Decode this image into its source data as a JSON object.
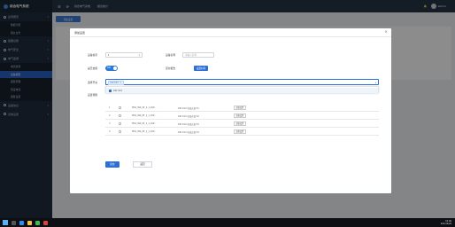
{
  "app": {
    "title": "综合电气系统"
  },
  "header": {
    "links": [
      "综合电气系统",
      "报表统计"
    ],
    "user": "admin"
  },
  "sidebar": {
    "items": [
      {
        "label": "全局概览",
        "icon": "home-icon"
      },
      {
        "label": "数据大屏",
        "sub": true
      },
      {
        "label": "报价业务",
        "sub": true
      },
      {
        "label": "提醒台账",
        "icon": "bell-icon"
      },
      {
        "label": "电气安全",
        "icon": "shield-icon"
      },
      {
        "label": "电气监测",
        "icon": "monitor-icon"
      },
      {
        "label": "电流监测",
        "sub": true
      },
      {
        "label": "设备报警",
        "sub": true,
        "active": true
      },
      {
        "label": "报警管理",
        "sub": true
      },
      {
        "label": "预设电流",
        "sub": true
      },
      {
        "label": "报警设置",
        "sub": true
      },
      {
        "label": "设备信息",
        "icon": "device-icon"
      },
      {
        "label": "系统设置",
        "icon": "gear-icon"
      }
    ]
  },
  "content": {
    "add_button": "添加设置"
  },
  "modal": {
    "title": "添加设置",
    "fields": {
      "device_no_label": "设备编号",
      "device_no_value": "1",
      "device_name_label": "设备名称",
      "device_name_placeholder": "请输入名称",
      "enable_label": "是否启用",
      "enable_value": "ON",
      "time_label": "定时报告",
      "time_button": "设置时间",
      "select_label": "选择开关",
      "select_tag": "DW 01X",
      "table_label": "设置规则"
    },
    "dropdown_option": "DW 01X",
    "table_rows": [
      {
        "no": "1",
        "code": "MSC_INK_KT_1_1_DW...",
        "name": "DW 01X 电流过载 01",
        "action": "高级设置"
      },
      {
        "no": "2",
        "code": "MSC_INK_KT_1_1_DW...",
        "name": "DW 01X 电流过载 02",
        "action": "高级设置"
      },
      {
        "no": "3",
        "code": "MSC_INK_KT_1_1_DW...",
        "name": "DW 01X 电流过载 03",
        "action": "高级设置"
      },
      {
        "no": "4",
        "code": "MSC_INK_KT_1_1_DW...",
        "name": "DW 01X 电流过载 04",
        "action": "高级设置"
      }
    ],
    "submit": "提交",
    "cancel": "返回"
  },
  "taskbar": {
    "time": "10:46",
    "date": "2021/9/26"
  },
  "colors": {
    "primary": "#2d6fd6",
    "sidebar": "#1f2d3d",
    "header": "#263445"
  }
}
